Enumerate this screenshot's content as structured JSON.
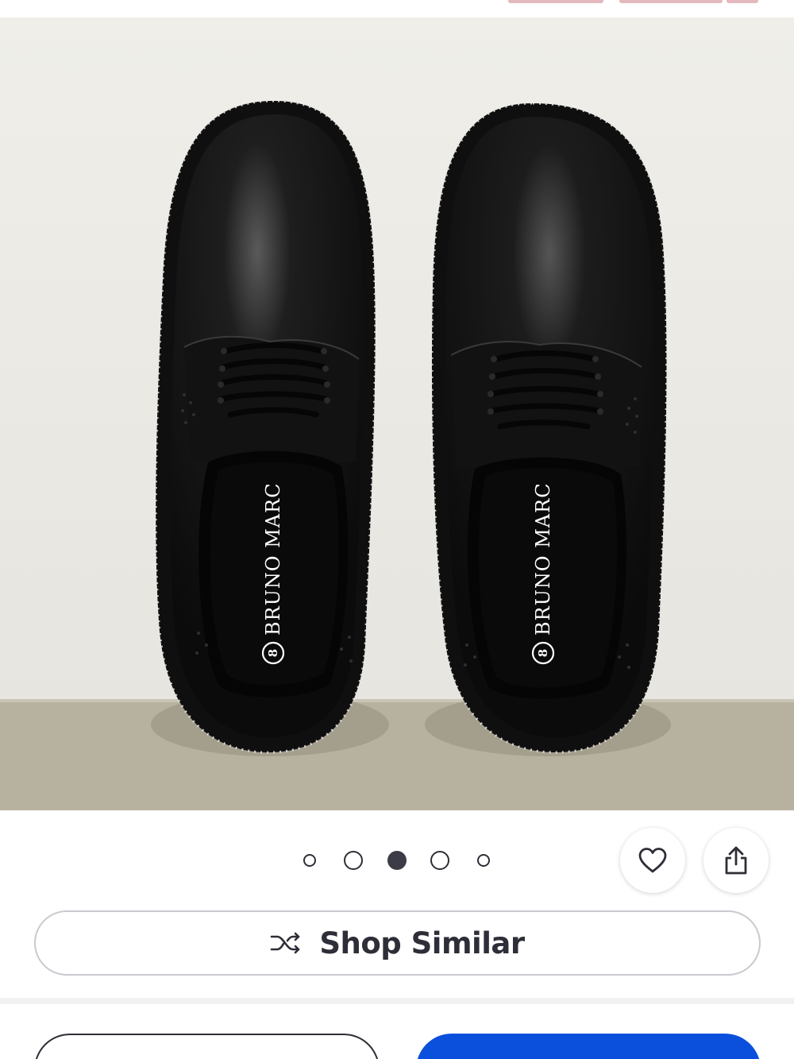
{
  "product_image": {
    "insole_brand_left": "BRUNO MARC",
    "insole_brand_right": "BRUNO MARC",
    "insole_badge": "8"
  },
  "carousel": {
    "total": 5,
    "active_index": 2
  },
  "actions": {
    "favorite_icon": "heart-icon",
    "share_icon": "share-icon"
  },
  "shop_similar": {
    "label": "Shop Similar",
    "icon": "shuffle-icon"
  },
  "colors": {
    "primary": "#0b50dc",
    "text": "#2e2e38",
    "border": "#c9c9cf"
  }
}
